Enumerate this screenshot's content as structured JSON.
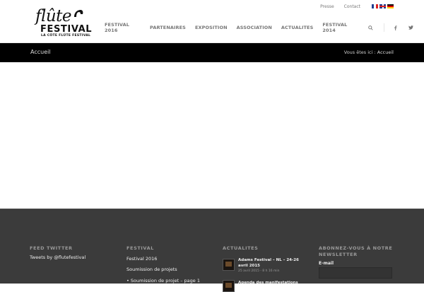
{
  "logo": {
    "script": "flûte",
    "name": "FESTIVAL",
    "tagline": "LA CÔTE FLÛTE FESTIVAL"
  },
  "topbar": {
    "links": [
      "Presse",
      "Contact"
    ],
    "flags": [
      "flag-fr-icon",
      "flag-en-icon",
      "flag-de-icon"
    ]
  },
  "nav": {
    "items": [
      "FESTIVAL 2016",
      "PARTENAIRES",
      "EXPOSITION",
      "ASSOCIATION",
      "ACTUALITES",
      "FESTIVAL 2014"
    ],
    "icons": [
      "search-icon",
      "facebook-icon",
      "twitter-icon"
    ]
  },
  "titlebar": {
    "title": "Accueil",
    "breadcrumb_prefix": "Vous êtes ici :",
    "breadcrumb_current": "Accueil"
  },
  "footer": {
    "col1": {
      "title": "FEED TWITTER",
      "text": "Tweets by @flutefestival"
    },
    "col2": {
      "title": "FESTIVAL",
      "links": [
        "Festival 2016",
        "Soumission de projets",
        "• Soumission de projet – page 1"
      ]
    },
    "col3": {
      "title": "ACTUALITES",
      "items": [
        {
          "title": "Adams Festival – NL – 24-26 avril 2015",
          "date": "25 avril 2015 - 8 h 16 min"
        },
        {
          "title": "Agenda des manifestations",
          "date": ""
        }
      ]
    },
    "col4": {
      "title": "ABONNEZ-VOUS À NOTRE NEWSLETTER",
      "email_label": "E-mail",
      "email_value": ""
    }
  },
  "colors": {
    "header_bg": "#ffffff",
    "titlebar_bg": "#000000",
    "footer_bg": "#3b3b3b",
    "nav_text": "#777777"
  }
}
